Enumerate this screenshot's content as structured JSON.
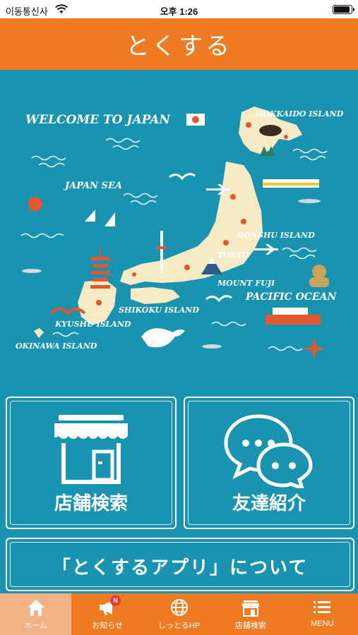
{
  "status_bar": {
    "carrier": "이동통신사",
    "time": "오후 1:26"
  },
  "header": {
    "title": "とくする"
  },
  "hero_map": {
    "welcome": "WELCOME TO JAPAN",
    "labels": {
      "hokkaido": "HOKKAIDO ISLAND",
      "japan_sea": "JAPAN SEA",
      "honshu": "HONSHU ISLAND",
      "tokyo": "TOKYO",
      "mount_fuji": "MOUNT FUJI",
      "pacific": "PACIFIC OCEAN",
      "shikoku": "SHIKOKU ISLAND",
      "kyushu": "KYUSHU ISLAND",
      "okinawa": "OKINAWA ISLAND"
    },
    "colors": {
      "sea": "#1a93b0",
      "land": "#f7ebc6",
      "accent": "#e4572e"
    }
  },
  "tiles": {
    "shop_search": {
      "label": "店舗検索",
      "icon": "storefront-icon"
    },
    "friend_intro": {
      "label": "友達紹介",
      "icon": "chat-bubbles-icon"
    },
    "about": {
      "label": "「とくするアプリ」について"
    }
  },
  "tab_bar": {
    "items": [
      {
        "label": "ホーム",
        "icon": "home-icon",
        "active": true
      },
      {
        "label": "お知らせ",
        "icon": "megaphone-icon",
        "badge": "N"
      },
      {
        "label": "しっとるHP",
        "icon": "globe-icon"
      },
      {
        "label": "店舗検索",
        "icon": "shop-icon"
      },
      {
        "label": "MENU",
        "icon": "menu-icon"
      }
    ]
  },
  "colors": {
    "primary": "#ee7a22",
    "active_tab": "#f3b285",
    "background": "#1a93b0"
  }
}
